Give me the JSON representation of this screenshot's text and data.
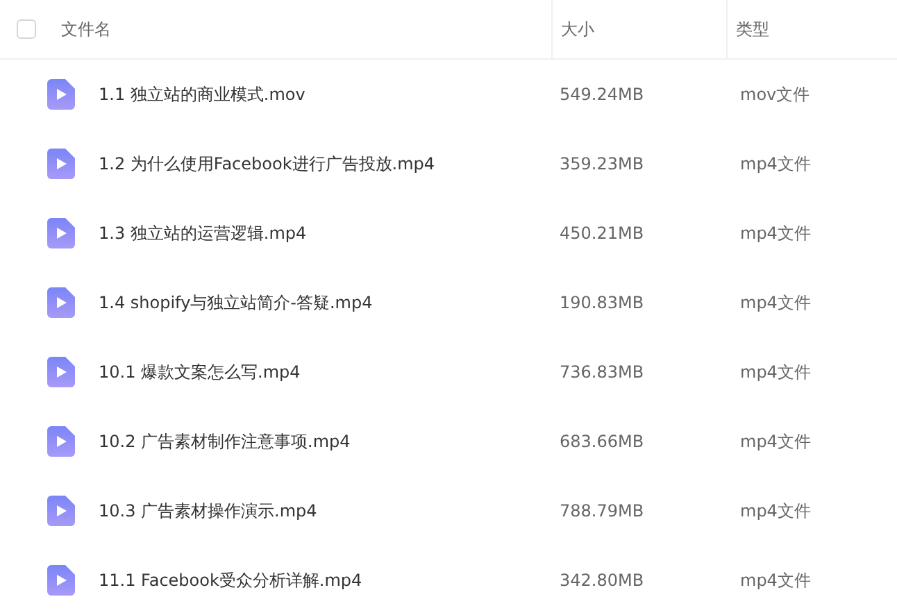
{
  "header": {
    "select_all": {
      "checked": false
    },
    "columns": [
      "文件名",
      "大小",
      "类型"
    ]
  },
  "files": [
    {
      "name": "1.1 独立站的商业模式.mov",
      "size": "549.24MB",
      "type": "mov文件"
    },
    {
      "name": "1.2 为什么使用Facebook进行广告投放.mp4",
      "size": "359.23MB",
      "type": "mp4文件"
    },
    {
      "name": "1.3 独立站的运营逻辑.mp4",
      "size": "450.21MB",
      "type": "mp4文件"
    },
    {
      "name": "1.4 shopify与独立站简介-答疑.mp4",
      "size": "190.83MB",
      "type": "mp4文件"
    },
    {
      "name": "10.1 爆款文案怎么写.mp4",
      "size": "736.83MB",
      "type": "mp4文件"
    },
    {
      "name": "10.2 广告素材制作注意事项.mp4",
      "size": "683.66MB",
      "type": "mp4文件"
    },
    {
      "name": "10.3 广告素材操作演示.mp4",
      "size": "788.79MB",
      "type": "mp4文件"
    },
    {
      "name": "11.1 Facebook受众分析详解.mp4",
      "size": "342.80MB",
      "type": "mp4文件"
    }
  ]
}
